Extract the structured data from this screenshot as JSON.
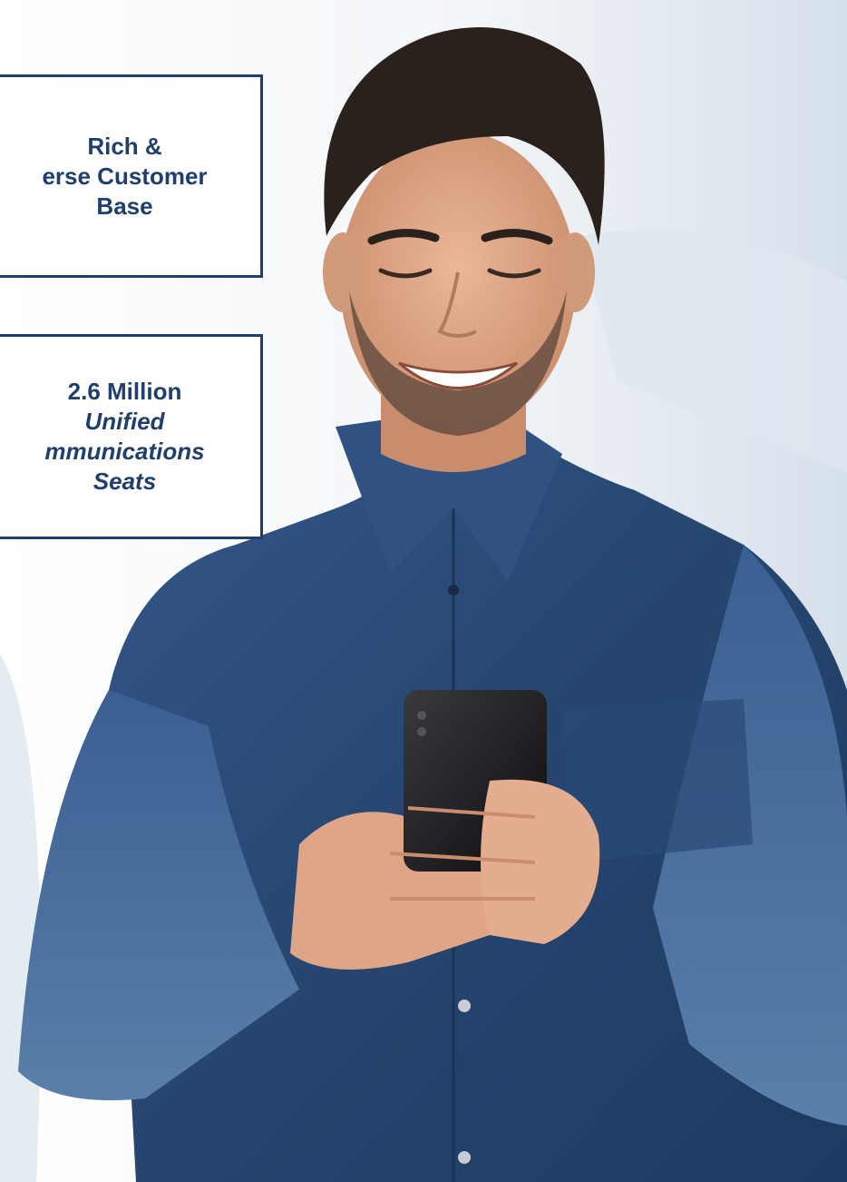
{
  "stats": [
    {
      "lines": [
        "Rich &",
        "erse Customer",
        "Base"
      ]
    },
    {
      "lines": [
        "2.6 Million",
        "Unified",
        "mmunications",
        "Seats"
      ]
    }
  ],
  "colors": {
    "box_border": "#1f3f6e",
    "box_text": "#1f3f6e",
    "shirt": "#2a4a72",
    "skin": "#e0a98a",
    "hair": "#2a211c",
    "background": "#eef2f6"
  }
}
